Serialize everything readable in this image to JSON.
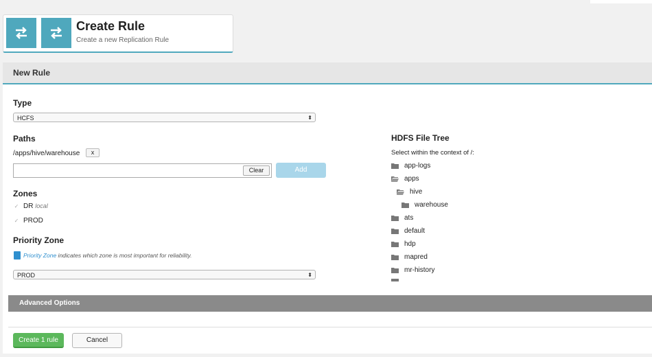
{
  "header": {
    "title": "Create Rule",
    "subtitle": "Create a new Replication Rule",
    "icons": [
      "transfer-icon",
      "transfer-icon"
    ]
  },
  "panel": {
    "title": "New Rule"
  },
  "type_section": {
    "label": "Type",
    "selected": "HCFS"
  },
  "paths": {
    "label": "Paths",
    "items": [
      {
        "path": "/apps/hive/warehouse",
        "remove_label": "x"
      }
    ],
    "input_value": "",
    "clear_label": "Clear",
    "add_label": "Add"
  },
  "zones": {
    "label": "Zones",
    "items": [
      {
        "name": "DR",
        "tag": "local",
        "checked": true
      },
      {
        "name": "PROD",
        "tag": "",
        "checked": true
      }
    ]
  },
  "priority_zone": {
    "label": "Priority Zone",
    "info_link": "Priority Zone",
    "info_rest": " indicates which zone is most important for reliability.",
    "selected": "PROD"
  },
  "file_tree": {
    "title": "HDFS File Tree",
    "context": "Select within the context of /:",
    "items": [
      {
        "label": "app-logs",
        "open": false
      },
      {
        "label": "apps",
        "open": true
      },
      {
        "label": "hive",
        "open": true
      },
      {
        "label": "warehouse",
        "open": false
      },
      {
        "label": "ats",
        "open": false
      },
      {
        "label": "default",
        "open": false
      },
      {
        "label": "hdp",
        "open": false
      },
      {
        "label": "mapred",
        "open": false
      },
      {
        "label": "mr-history",
        "open": false
      }
    ]
  },
  "advanced": {
    "label": "Advanced Options"
  },
  "footer": {
    "create_label": "Create 1 rule",
    "cancel_label": "Cancel"
  },
  "colors": {
    "accent": "#4fa8bd",
    "create": "#5cb85c",
    "add": "#a9d6ea",
    "link": "#2f8fce"
  }
}
